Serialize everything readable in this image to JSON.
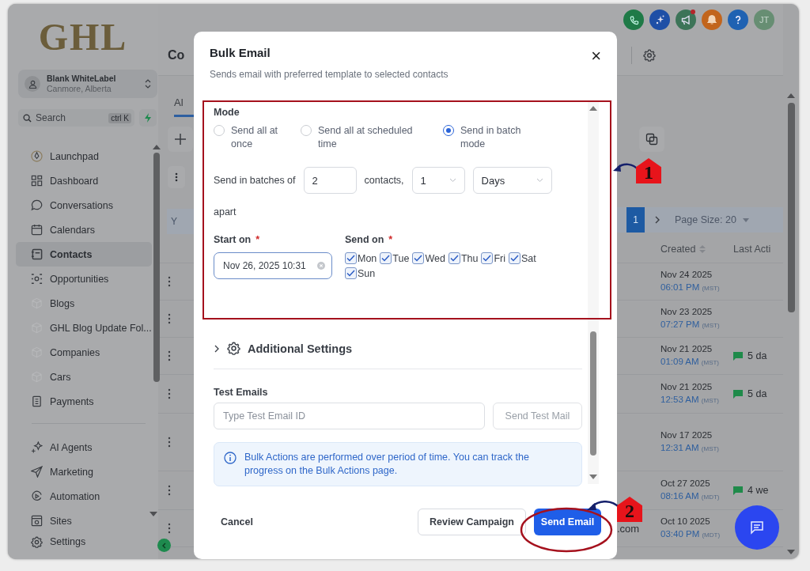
{
  "sidebar": {
    "logo": "GHL",
    "account": {
      "name": "Blank WhiteLabel",
      "location": "Canmore, Alberta"
    },
    "search": {
      "placeholder": "Search",
      "shortcut": "ctrl K"
    },
    "nav": [
      {
        "label": "Launchpad",
        "selected": false
      },
      {
        "label": "Dashboard",
        "selected": false
      },
      {
        "label": "Conversations",
        "selected": false
      },
      {
        "label": "Calendars",
        "selected": false
      },
      {
        "label": "Contacts",
        "selected": true
      },
      {
        "label": "Opportunities",
        "selected": false
      },
      {
        "label": "Blogs",
        "selected": false
      },
      {
        "label": "GHL Blog Update Fol...",
        "selected": false
      },
      {
        "label": "Companies",
        "selected": false
      },
      {
        "label": "Cars",
        "selected": false
      },
      {
        "label": "Payments",
        "selected": false
      }
    ],
    "nav_secondary": [
      {
        "label": "AI Agents",
        "selected": false
      },
      {
        "label": "Marketing",
        "selected": false
      },
      {
        "label": "Automation",
        "selected": false
      },
      {
        "label": "Sites",
        "selected": false
      }
    ],
    "footer_item": {
      "label": "Settings"
    }
  },
  "topbar": {
    "icons": [
      {
        "kind": "phone",
        "color": "#1f7a47"
      },
      {
        "kind": "sparkle",
        "color": "#1e4fa6"
      },
      {
        "kind": "megaphone",
        "color": "#3c7458"
      },
      {
        "kind": "bell",
        "color": "#c2651c"
      },
      {
        "kind": "help",
        "color": "#1f62b2"
      }
    ],
    "avatar": "JT"
  },
  "page": {
    "title": "Co",
    "tab": "Al",
    "list_label": "Y",
    "pagination": {
      "page": "1",
      "page_size": "Page Size: 20"
    },
    "columns": [
      "Created",
      "Last Acti"
    ],
    "rows": [
      {
        "date": "Nov 24 2025",
        "time": "06:01 PM",
        "zone": "(MST)"
      },
      {
        "date": "Nov 23 2025",
        "time": "07:27 PM",
        "zone": "(MST)"
      },
      {
        "date": "Nov 21 2025",
        "time": "01:09 AM",
        "zone": "(MST)",
        "last_activity": "5 da"
      },
      {
        "date": "Nov 21 2025",
        "time": "12:53 AM",
        "zone": "(MST)",
        "last_activity": "5 da"
      },
      {
        "date": "Nov 17 2025",
        "time": "12:31 AM",
        "zone": "(MST)"
      },
      {
        "date": "Oct 27 2025",
        "time": "08:16 AM",
        "zone": "(MDT)",
        "last_activity": "4 we"
      },
      {
        "date": "Oct 10 2025",
        "time": "03:40 PM",
        "zone": "(MDT)",
        "email": ".com"
      }
    ]
  },
  "modal": {
    "title": "Bulk Email",
    "subtitle": "Sends email with preferred template to selected contacts",
    "close": "×",
    "mode_label": "Mode",
    "modes": [
      {
        "label": "Send all at once",
        "selected": false
      },
      {
        "label": "Send all at scheduled time",
        "selected": false
      },
      {
        "label": "Send in batch mode",
        "selected": true
      }
    ],
    "batch": {
      "label": "Send in batches of",
      "size": "2",
      "unit": "contacts,",
      "interval": "1",
      "period": "Days",
      "suffix": "apart"
    },
    "start_on": {
      "label": "Start on",
      "required_mark": "*",
      "value": "Nov 26, 2025 10:31"
    },
    "send_on": {
      "label": "Send on",
      "required_mark": "*",
      "days": [
        {
          "label": "Mon",
          "checked": true
        },
        {
          "label": "Tue",
          "checked": true
        },
        {
          "label": "Wed",
          "checked": true
        },
        {
          "label": "Thu",
          "checked": true
        },
        {
          "label": "Fri",
          "checked": true
        },
        {
          "label": "Sat",
          "checked": true
        },
        {
          "label": "Sun",
          "checked": true
        }
      ]
    },
    "additional_settings": {
      "label": "Additional Settings",
      "expanded": false
    },
    "test_emails": {
      "label": "Test Emails",
      "placeholder": "Type Test Email ID",
      "button": "Send Test Mail",
      "disabled": true
    },
    "info": "Bulk Actions are performed over period of time. You can track the progress on the Bulk Actions page.",
    "buttons": [
      {
        "label": "Cancel",
        "kind": "text"
      },
      {
        "label": "Review Campaign",
        "kind": "outline"
      },
      {
        "label": "Send Email",
        "kind": "primary"
      }
    ]
  },
  "annotations": [
    {
      "label": "1"
    },
    {
      "label": "2"
    }
  ]
}
